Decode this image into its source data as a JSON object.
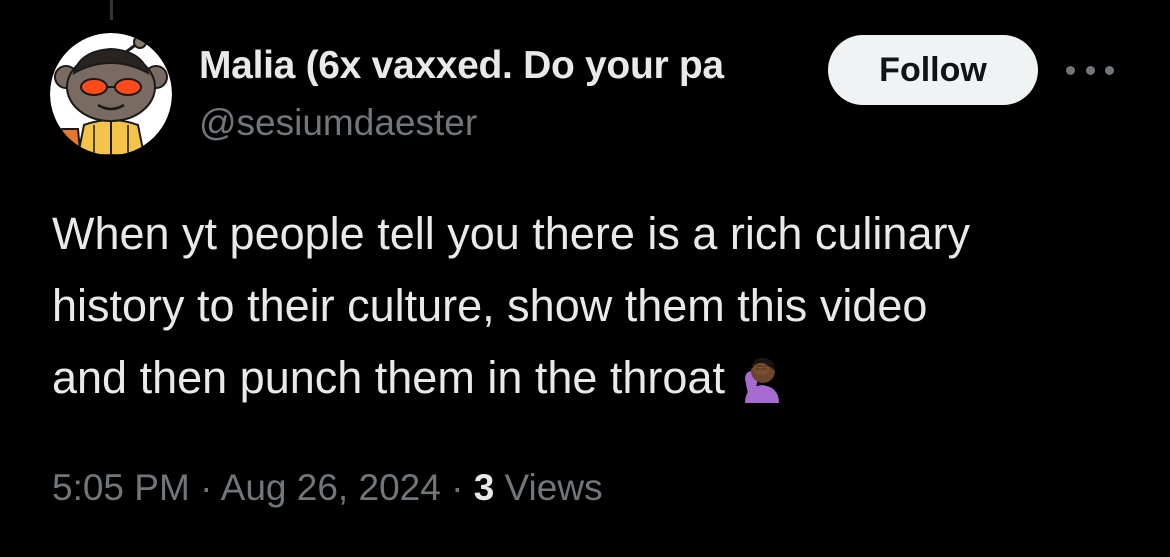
{
  "author": {
    "display_name": "Malia (6x vaxxed. Do your pa",
    "handle": "@sesiumdaester",
    "avatar_icon": "cartoon-avatar-icon"
  },
  "actions": {
    "follow_label": "Follow",
    "more_icon": "more-options-icon"
  },
  "tweet": {
    "lines": [
      "When yt people tell you there is a rich culinary",
      "history to their culture, show them this video",
      "and then punch them in the throat"
    ],
    "emoji_icon": "facepalm-emoji-icon"
  },
  "meta": {
    "time": "5:05 PM",
    "separator": "·",
    "date": "Aug 26, 2024",
    "views_count": "3",
    "views_label": "Views"
  },
  "colors": {
    "background": "#000000",
    "primary_text": "#e7e9ea",
    "secondary_text": "#71767b",
    "follow_bg": "#eff3f4",
    "follow_text": "#0f1419"
  }
}
